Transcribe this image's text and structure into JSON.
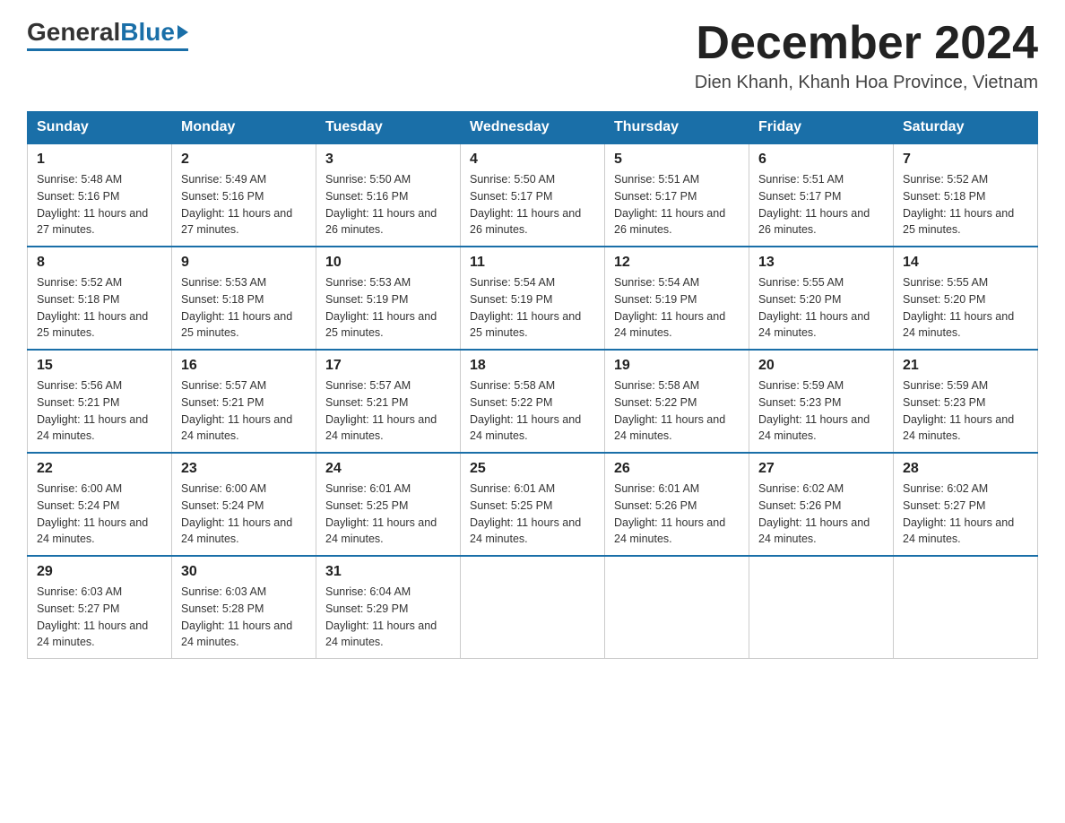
{
  "header": {
    "logo_general": "General",
    "logo_blue": "Blue",
    "month_title": "December 2024",
    "location": "Dien Khanh, Khanh Hoa Province, Vietnam"
  },
  "days_of_week": [
    "Sunday",
    "Monday",
    "Tuesday",
    "Wednesday",
    "Thursday",
    "Friday",
    "Saturday"
  ],
  "weeks": [
    [
      {
        "day": "1",
        "sunrise": "5:48 AM",
        "sunset": "5:16 PM",
        "daylight": "11 hours and 27 minutes."
      },
      {
        "day": "2",
        "sunrise": "5:49 AM",
        "sunset": "5:16 PM",
        "daylight": "11 hours and 27 minutes."
      },
      {
        "day": "3",
        "sunrise": "5:50 AM",
        "sunset": "5:16 PM",
        "daylight": "11 hours and 26 minutes."
      },
      {
        "day": "4",
        "sunrise": "5:50 AM",
        "sunset": "5:17 PM",
        "daylight": "11 hours and 26 minutes."
      },
      {
        "day": "5",
        "sunrise": "5:51 AM",
        "sunset": "5:17 PM",
        "daylight": "11 hours and 26 minutes."
      },
      {
        "day": "6",
        "sunrise": "5:51 AM",
        "sunset": "5:17 PM",
        "daylight": "11 hours and 26 minutes."
      },
      {
        "day": "7",
        "sunrise": "5:52 AM",
        "sunset": "5:18 PM",
        "daylight": "11 hours and 25 minutes."
      }
    ],
    [
      {
        "day": "8",
        "sunrise": "5:52 AM",
        "sunset": "5:18 PM",
        "daylight": "11 hours and 25 minutes."
      },
      {
        "day": "9",
        "sunrise": "5:53 AM",
        "sunset": "5:18 PM",
        "daylight": "11 hours and 25 minutes."
      },
      {
        "day": "10",
        "sunrise": "5:53 AM",
        "sunset": "5:19 PM",
        "daylight": "11 hours and 25 minutes."
      },
      {
        "day": "11",
        "sunrise": "5:54 AM",
        "sunset": "5:19 PM",
        "daylight": "11 hours and 25 minutes."
      },
      {
        "day": "12",
        "sunrise": "5:54 AM",
        "sunset": "5:19 PM",
        "daylight": "11 hours and 24 minutes."
      },
      {
        "day": "13",
        "sunrise": "5:55 AM",
        "sunset": "5:20 PM",
        "daylight": "11 hours and 24 minutes."
      },
      {
        "day": "14",
        "sunrise": "5:55 AM",
        "sunset": "5:20 PM",
        "daylight": "11 hours and 24 minutes."
      }
    ],
    [
      {
        "day": "15",
        "sunrise": "5:56 AM",
        "sunset": "5:21 PM",
        "daylight": "11 hours and 24 minutes."
      },
      {
        "day": "16",
        "sunrise": "5:57 AM",
        "sunset": "5:21 PM",
        "daylight": "11 hours and 24 minutes."
      },
      {
        "day": "17",
        "sunrise": "5:57 AM",
        "sunset": "5:21 PM",
        "daylight": "11 hours and 24 minutes."
      },
      {
        "day": "18",
        "sunrise": "5:58 AM",
        "sunset": "5:22 PM",
        "daylight": "11 hours and 24 minutes."
      },
      {
        "day": "19",
        "sunrise": "5:58 AM",
        "sunset": "5:22 PM",
        "daylight": "11 hours and 24 minutes."
      },
      {
        "day": "20",
        "sunrise": "5:59 AM",
        "sunset": "5:23 PM",
        "daylight": "11 hours and 24 minutes."
      },
      {
        "day": "21",
        "sunrise": "5:59 AM",
        "sunset": "5:23 PM",
        "daylight": "11 hours and 24 minutes."
      }
    ],
    [
      {
        "day": "22",
        "sunrise": "6:00 AM",
        "sunset": "5:24 PM",
        "daylight": "11 hours and 24 minutes."
      },
      {
        "day": "23",
        "sunrise": "6:00 AM",
        "sunset": "5:24 PM",
        "daylight": "11 hours and 24 minutes."
      },
      {
        "day": "24",
        "sunrise": "6:01 AM",
        "sunset": "5:25 PM",
        "daylight": "11 hours and 24 minutes."
      },
      {
        "day": "25",
        "sunrise": "6:01 AM",
        "sunset": "5:25 PM",
        "daylight": "11 hours and 24 minutes."
      },
      {
        "day": "26",
        "sunrise": "6:01 AM",
        "sunset": "5:26 PM",
        "daylight": "11 hours and 24 minutes."
      },
      {
        "day": "27",
        "sunrise": "6:02 AM",
        "sunset": "5:26 PM",
        "daylight": "11 hours and 24 minutes."
      },
      {
        "day": "28",
        "sunrise": "6:02 AM",
        "sunset": "5:27 PM",
        "daylight": "11 hours and 24 minutes."
      }
    ],
    [
      {
        "day": "29",
        "sunrise": "6:03 AM",
        "sunset": "5:27 PM",
        "daylight": "11 hours and 24 minutes."
      },
      {
        "day": "30",
        "sunrise": "6:03 AM",
        "sunset": "5:28 PM",
        "daylight": "11 hours and 24 minutes."
      },
      {
        "day": "31",
        "sunrise": "6:04 AM",
        "sunset": "5:29 PM",
        "daylight": "11 hours and 24 minutes."
      },
      null,
      null,
      null,
      null
    ]
  ]
}
